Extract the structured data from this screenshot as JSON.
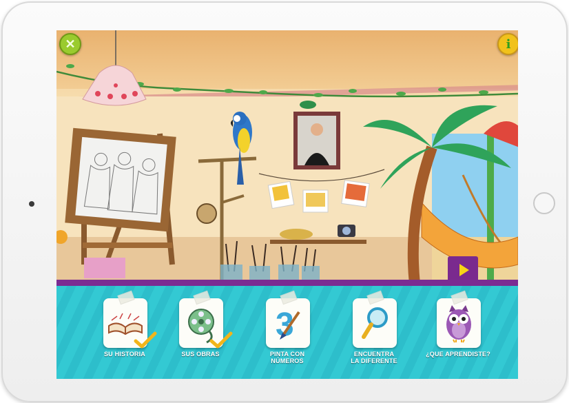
{
  "toolbar": {
    "close_symbol": "✕",
    "info_symbol": "i"
  },
  "colors": {
    "accent_purple": "#7b2c92",
    "menu_cyan": "#33c9d3",
    "close_green": "#9acb2e",
    "info_yellow": "#f1c21b",
    "play_yellow": "#f7d417"
  },
  "menu": {
    "items": [
      {
        "label_line1": "SU HISTORIA",
        "label_line2": "",
        "icon": "open-book-icon",
        "completed": true
      },
      {
        "label_line1": "SUS OBRAS",
        "label_line2": "",
        "icon": "film-reel-icon",
        "completed": true
      },
      {
        "label_line1": "PINTA CON",
        "label_line2": "NÚMEROS",
        "icon": "number-three-paintbrush-icon",
        "completed": false
      },
      {
        "label_line1": "ENCUENTRA",
        "label_line2": "LA DIFERENTE",
        "icon": "magnifying-glass-icon",
        "completed": false
      },
      {
        "label_line1": "¿QUE APRENDISTE?",
        "label_line2": "",
        "icon": "owl-icon",
        "completed": false
      }
    ]
  }
}
